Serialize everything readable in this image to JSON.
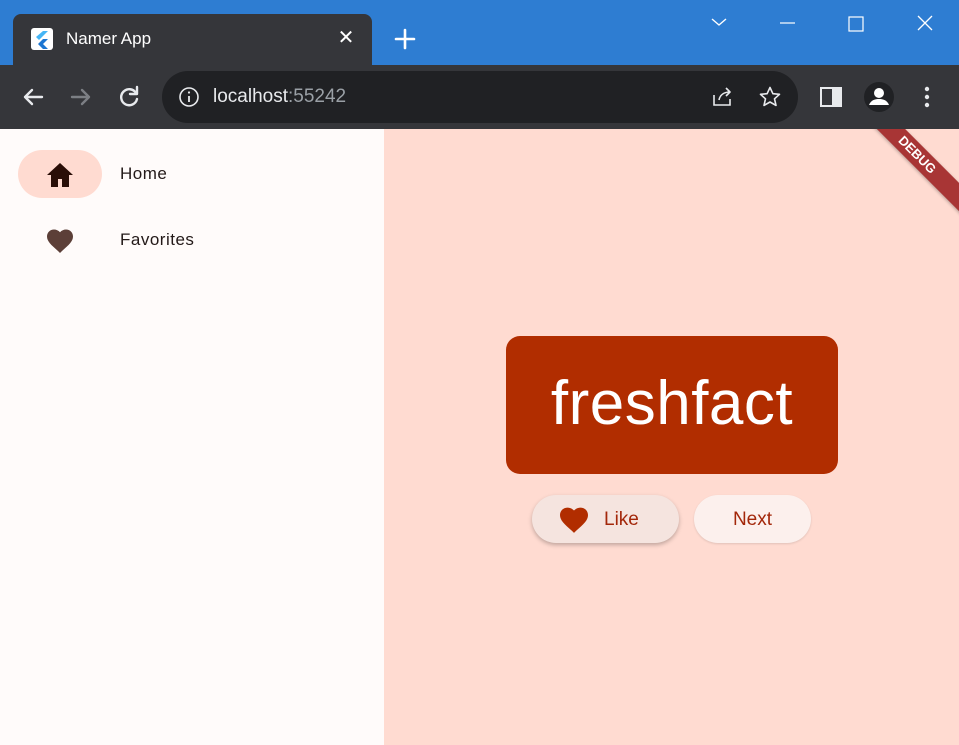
{
  "browser": {
    "tab_title": "Namer App",
    "url_host": "localhost",
    "url_port": ":55242"
  },
  "nav": {
    "items": [
      {
        "label": "Home",
        "icon": "home-icon",
        "selected": true
      },
      {
        "label": "Favorites",
        "icon": "favorite-icon",
        "selected": false
      }
    ]
  },
  "main": {
    "word": "freshfact",
    "like_label": "Like",
    "next_label": "Next",
    "debug_label": "DEBUG"
  },
  "colors": {
    "titlebar": "#2e7dd2",
    "accent": "#b12d00",
    "background": "#ffdbd1"
  }
}
